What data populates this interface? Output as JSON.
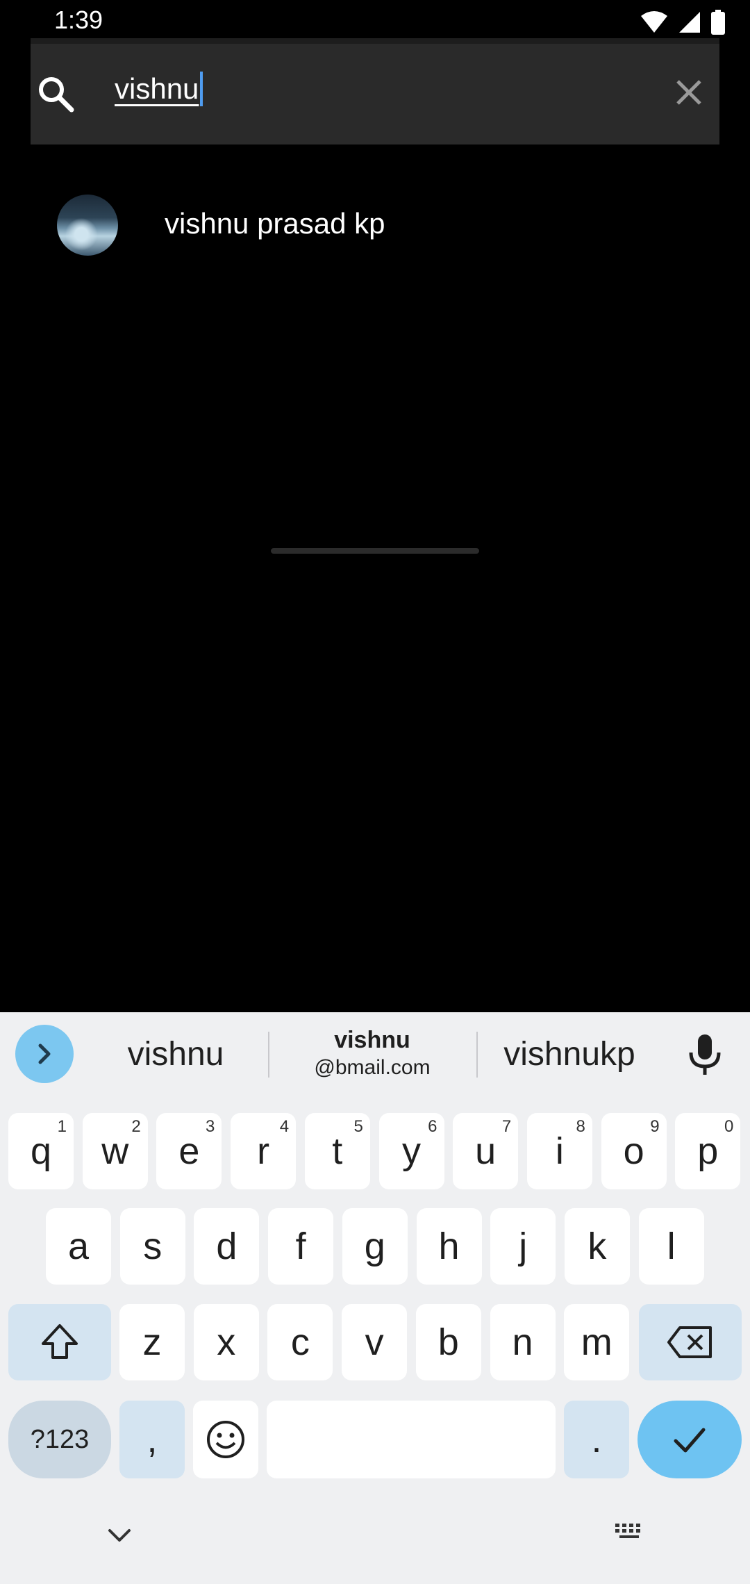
{
  "status_bar": {
    "time": "1:39"
  },
  "search": {
    "query": "vishnu"
  },
  "results": [
    {
      "name": "vishnu prasad kp"
    }
  ],
  "keyboard": {
    "suggestions": {
      "first": "vishnu",
      "second_line1": "vishnu",
      "second_line2": "@bmail.com",
      "third": "vishnukp"
    },
    "row1": [
      {
        "k": "q",
        "h": "1"
      },
      {
        "k": "w",
        "h": "2"
      },
      {
        "k": "e",
        "h": "3"
      },
      {
        "k": "r",
        "h": "4"
      },
      {
        "k": "t",
        "h": "5"
      },
      {
        "k": "y",
        "h": "6"
      },
      {
        "k": "u",
        "h": "7"
      },
      {
        "k": "i",
        "h": "8"
      },
      {
        "k": "o",
        "h": "9"
      },
      {
        "k": "p",
        "h": "0"
      }
    ],
    "row2": [
      "a",
      "s",
      "d",
      "f",
      "g",
      "h",
      "j",
      "k",
      "l"
    ],
    "row3": [
      "z",
      "x",
      "c",
      "v",
      "b",
      "n",
      "m"
    ],
    "symbols_label": "?123",
    "comma_label": ",",
    "period_label": "."
  },
  "colors": {
    "accent": "#4f9cf0",
    "enter_key": "#6ec3f2",
    "keyboard_bg": "#eff0f2"
  }
}
